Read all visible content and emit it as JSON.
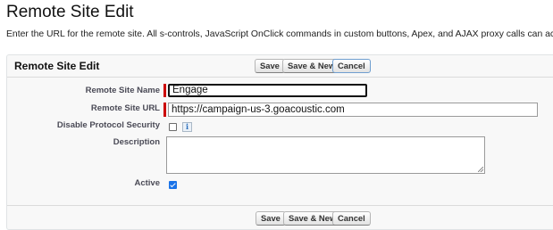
{
  "page": {
    "title": "Remote Site Edit",
    "intro": "Enter the URL for the remote site. All s-controls, JavaScript OnClick commands in custom buttons, Apex, and AJAX proxy calls can access this Web ad"
  },
  "panel": {
    "title": "Remote Site Edit"
  },
  "buttons": {
    "save": "Save",
    "save_new": "Save & New",
    "cancel": "Cancel"
  },
  "form": {
    "remote_site_name": {
      "label": "Remote Site Name",
      "value": "Engage"
    },
    "remote_site_url": {
      "label": "Remote Site URL",
      "value": "https://campaign-us-3.goacoustic.com"
    },
    "disable_protocol_security": {
      "label": "Disable Protocol Security",
      "checked": false
    },
    "description": {
      "label": "Description",
      "value": ""
    },
    "active": {
      "label": "Active",
      "checked": true
    }
  },
  "icons": {
    "info": "info-icon",
    "info_glyph": "i"
  },
  "colors": {
    "required_bar": "#cc0000",
    "checkbox_checked": "#1a73e8"
  }
}
